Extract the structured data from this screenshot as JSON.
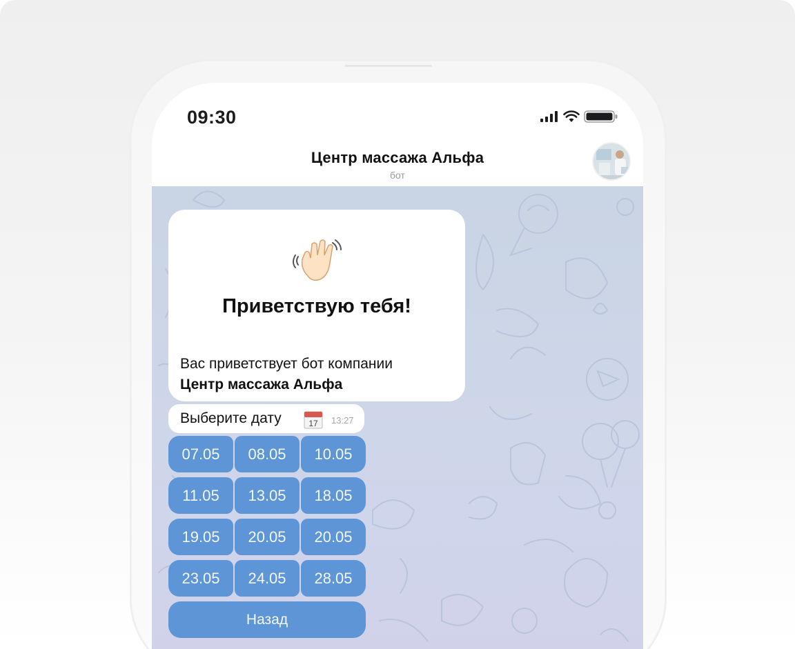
{
  "status_bar": {
    "time": "09:30",
    "icons": [
      "signal-icon",
      "wifi-icon",
      "battery-icon"
    ]
  },
  "chat_header": {
    "title": "Центр массажа Альфа",
    "subtitle": "бот",
    "avatar_icon": "bot-avatar"
  },
  "messages": {
    "welcome": {
      "icon": "waving-hand-icon",
      "greeting": "Приветствую тебя!",
      "line1": "Вас приветствует бот компании",
      "line2": "Центр массажа Альфа"
    },
    "select_date": {
      "text": "Выберите дату",
      "icon": "calendar-icon",
      "calendar_day": "17",
      "time": "13:27"
    }
  },
  "keyboard": {
    "rows": [
      [
        "07.05",
        "08.05",
        "10.05"
      ],
      [
        "11.05",
        "13.05",
        "18.05"
      ],
      [
        "19.05",
        "20.05",
        "20.05"
      ],
      [
        "23.05",
        "24.05",
        "28.05"
      ]
    ],
    "back_label": "Назад"
  },
  "colors": {
    "button_blue": "#5d95d6",
    "chat_background": "#cdd6e8",
    "bubble": "#ffffff"
  }
}
